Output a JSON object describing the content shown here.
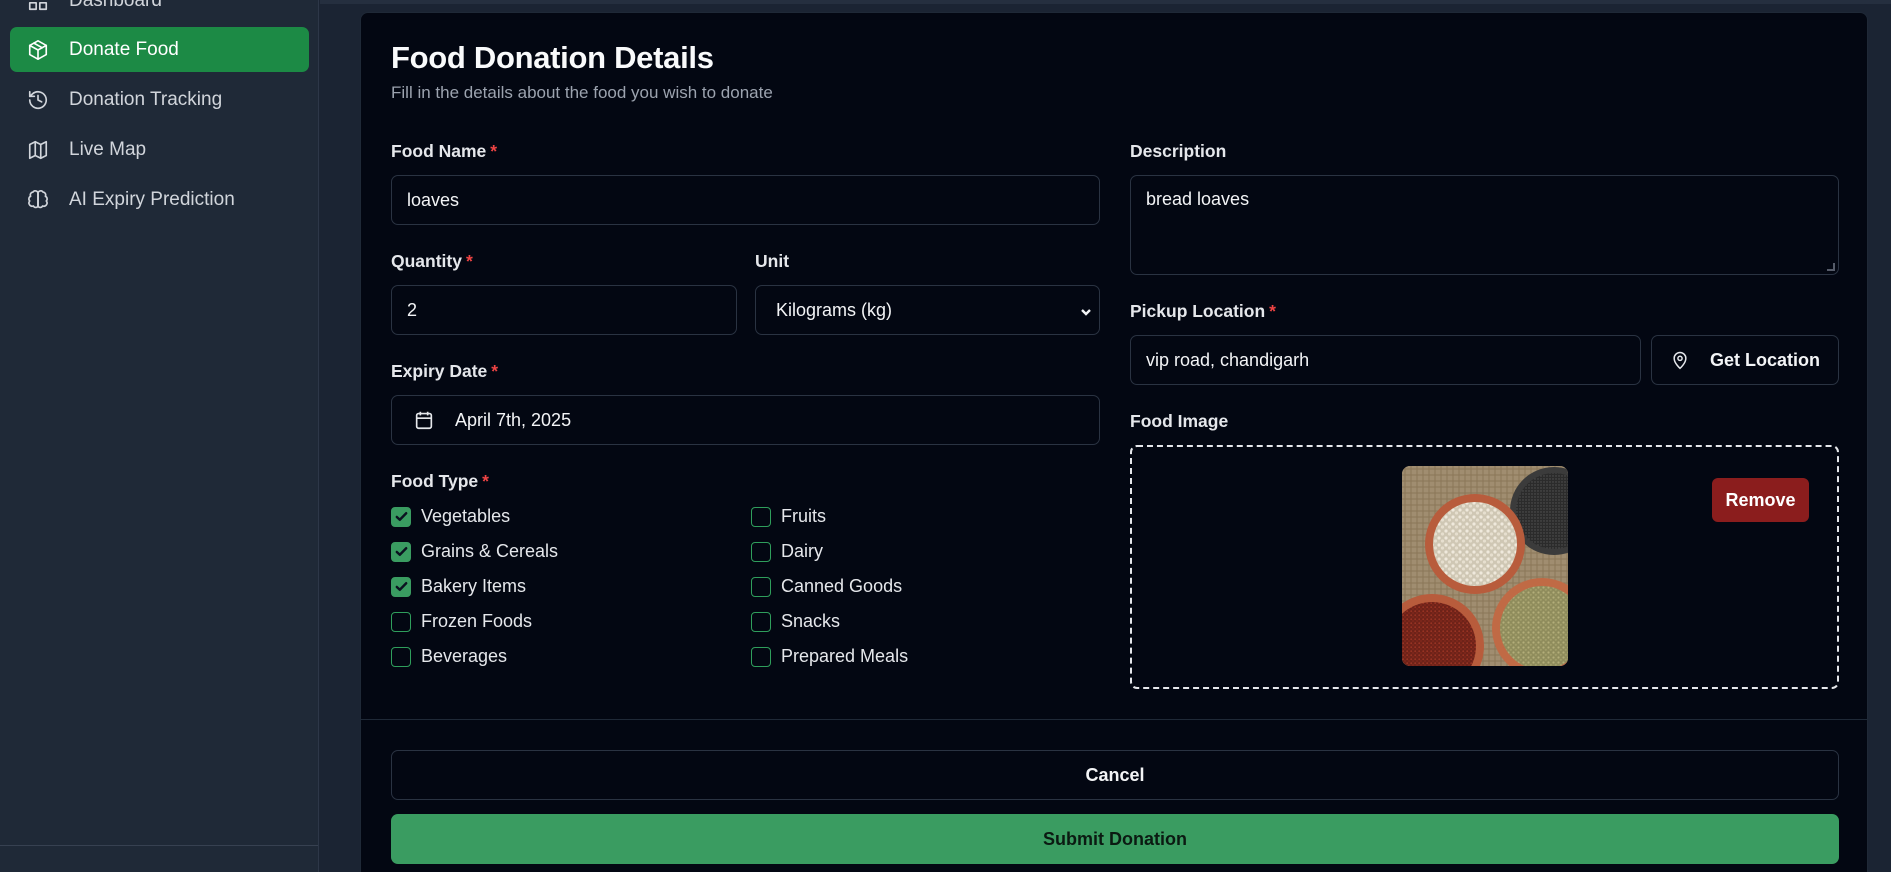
{
  "sidebar": {
    "items": [
      {
        "label": "Dashboard",
        "icon": "dashboard-icon"
      },
      {
        "label": "Donate Food",
        "icon": "package-icon",
        "active": true
      },
      {
        "label": "Donation Tracking",
        "icon": "history-icon"
      },
      {
        "label": "Live Map",
        "icon": "map-icon"
      },
      {
        "label": "AI Expiry Prediction",
        "icon": "brain-icon"
      }
    ]
  },
  "form": {
    "title": "Food Donation Details",
    "subtitle": "Fill in the details about the food you wish to donate",
    "required_mark": "*",
    "food_name": {
      "label": "Food Name",
      "value": "loaves"
    },
    "description": {
      "label": "Description",
      "value": "bread loaves"
    },
    "quantity": {
      "label": "Quantity",
      "value": "2"
    },
    "unit": {
      "label": "Unit",
      "value": "Kilograms (kg)"
    },
    "pickup": {
      "label": "Pickup Location",
      "value": "vip road, chandigarh",
      "button": "Get Location"
    },
    "expiry": {
      "label": "Expiry Date",
      "value": "April 7th, 2025"
    },
    "food_image": {
      "label": "Food Image",
      "remove": "Remove"
    },
    "food_type": {
      "label": "Food Type",
      "options": [
        {
          "label": "Vegetables",
          "checked": true
        },
        {
          "label": "Fruits",
          "checked": false
        },
        {
          "label": "Grains & Cereals",
          "checked": true
        },
        {
          "label": "Dairy",
          "checked": false
        },
        {
          "label": "Bakery Items",
          "checked": true
        },
        {
          "label": "Canned Goods",
          "checked": false
        },
        {
          "label": "Frozen Foods",
          "checked": false
        },
        {
          "label": "Snacks",
          "checked": false
        },
        {
          "label": "Beverages",
          "checked": false
        },
        {
          "label": "Prepared Meals",
          "checked": false
        }
      ]
    },
    "cancel": "Cancel",
    "submit": "Submit Donation"
  },
  "colors": {
    "accent_active": "#1c8a45",
    "submit": "#3a9c61",
    "remove": "#8b1d1d",
    "required": "#ef4444"
  }
}
